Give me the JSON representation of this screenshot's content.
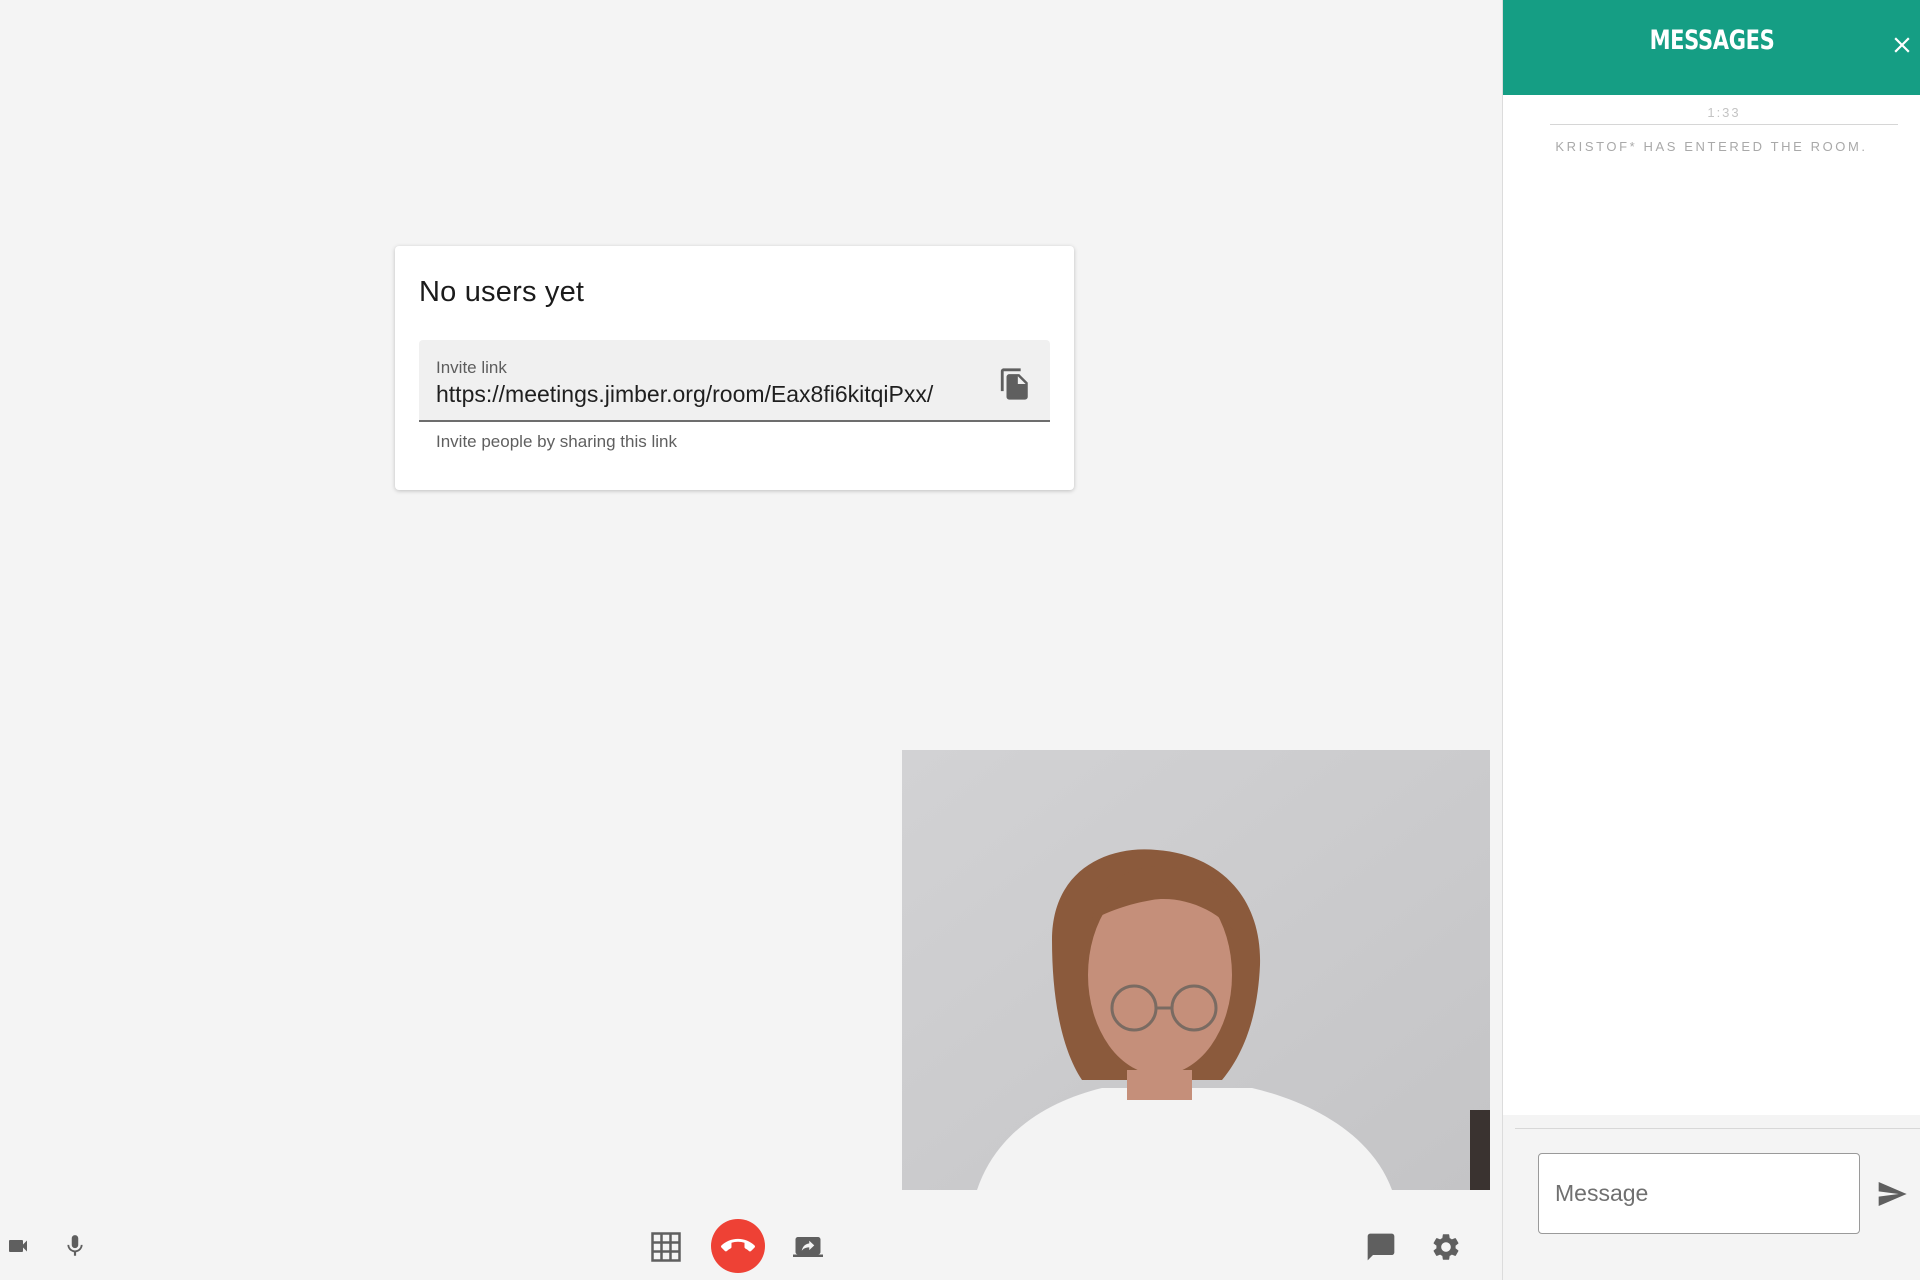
{
  "invite": {
    "title": "No users yet",
    "field_label": "Invite link",
    "link": "https://meetings.jimber.org/room/Eax8fi6kitqiPxx/",
    "helper": "Invite people by sharing this link"
  },
  "messages": {
    "title": "MESSAGES",
    "timestamp": "1:33",
    "system_message": "KRISTOF* HAS ENTERED THE ROOM.",
    "input_placeholder": "Message"
  },
  "colors": {
    "accent": "#159e84",
    "hangup": "#ee4135",
    "icon": "#5f5f5f"
  },
  "icons": {
    "toolbar_left": [
      "camera-icon",
      "microphone-icon"
    ],
    "toolbar_center": [
      "grid-view-icon",
      "hang-up-icon",
      "screen-share-icon"
    ],
    "toolbar_right": [
      "chat-icon",
      "settings-icon"
    ],
    "panel": [
      "close-icon",
      "send-icon"
    ],
    "card": [
      "copy-icon"
    ]
  }
}
